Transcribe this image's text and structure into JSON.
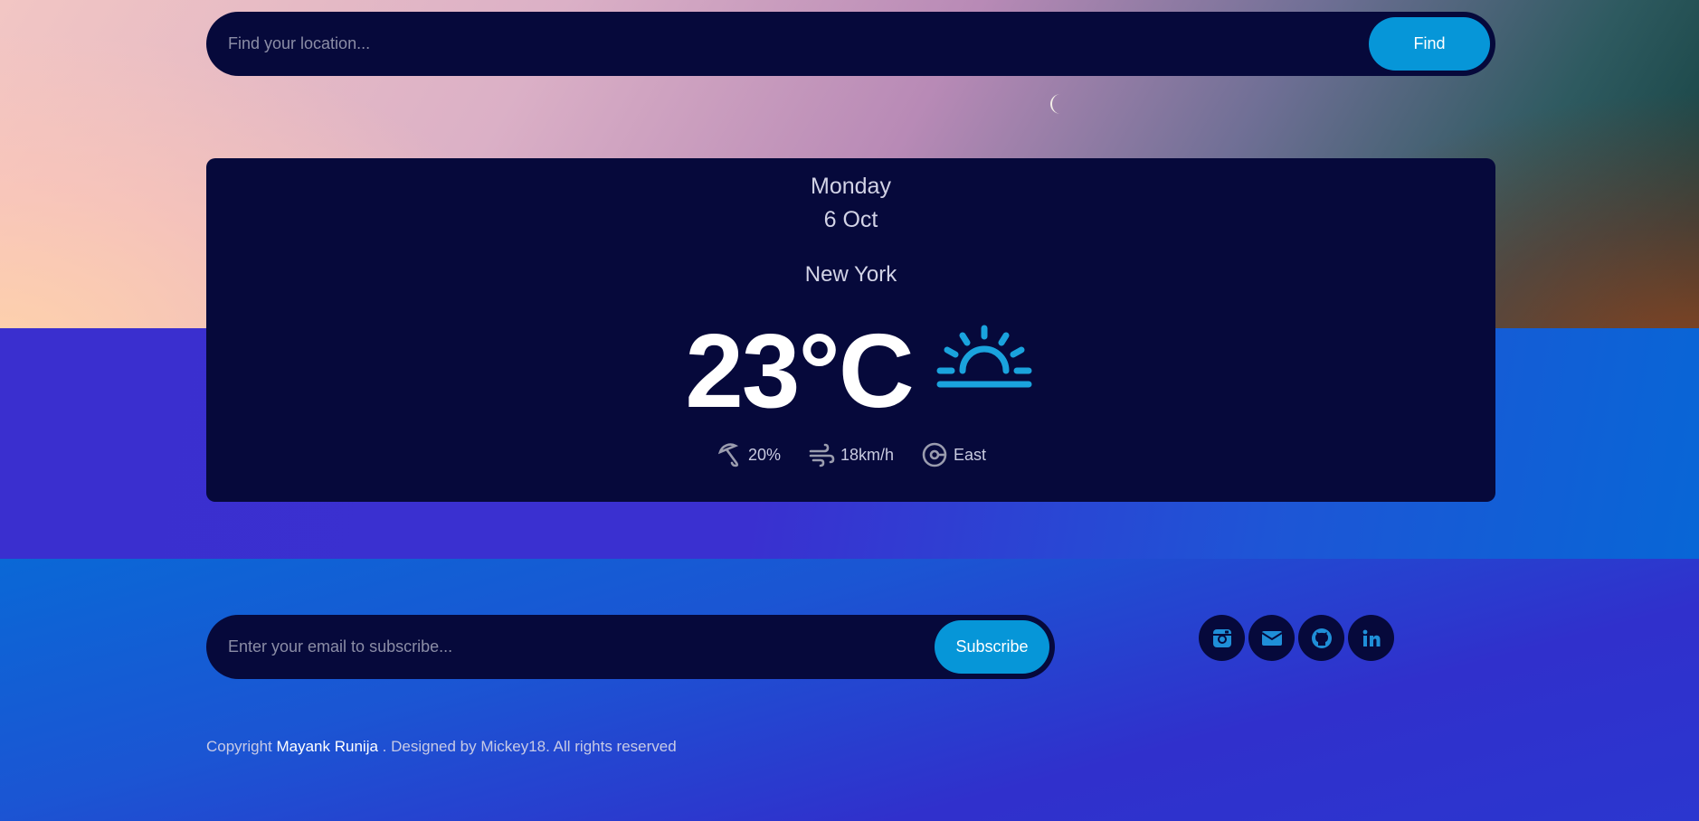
{
  "search": {
    "placeholder": "Find your location...",
    "button_label": "Find"
  },
  "theme_toggle": {
    "icon": "moon-icon"
  },
  "weather": {
    "day": "Monday",
    "date": "6 Oct",
    "city": "New York",
    "temperature": "23°C",
    "condition_icon": "sunrise-icon",
    "humidity": {
      "icon": "umbrella-icon",
      "value": "20%"
    },
    "wind_speed": {
      "icon": "wind-icon",
      "value": "18km/h"
    },
    "wind_direction": {
      "icon": "compass-icon",
      "value": "East"
    }
  },
  "subscribe": {
    "placeholder": "Enter your email to subscribe...",
    "button_label": "Subscribe"
  },
  "social_links": [
    {
      "icon": "instagram-icon"
    },
    {
      "icon": "email-icon"
    },
    {
      "icon": "github-icon"
    },
    {
      "icon": "linkedin-icon"
    }
  ],
  "footer": {
    "copyright_prefix": "Copyright ",
    "author": "Mayank Runija",
    "copyright_suffix": " . Designed by Mickey18. All rights reserved"
  },
  "colors": {
    "panel": "#06093b",
    "accent": "#0696d8",
    "icon_accent": "#1aa3dd"
  }
}
